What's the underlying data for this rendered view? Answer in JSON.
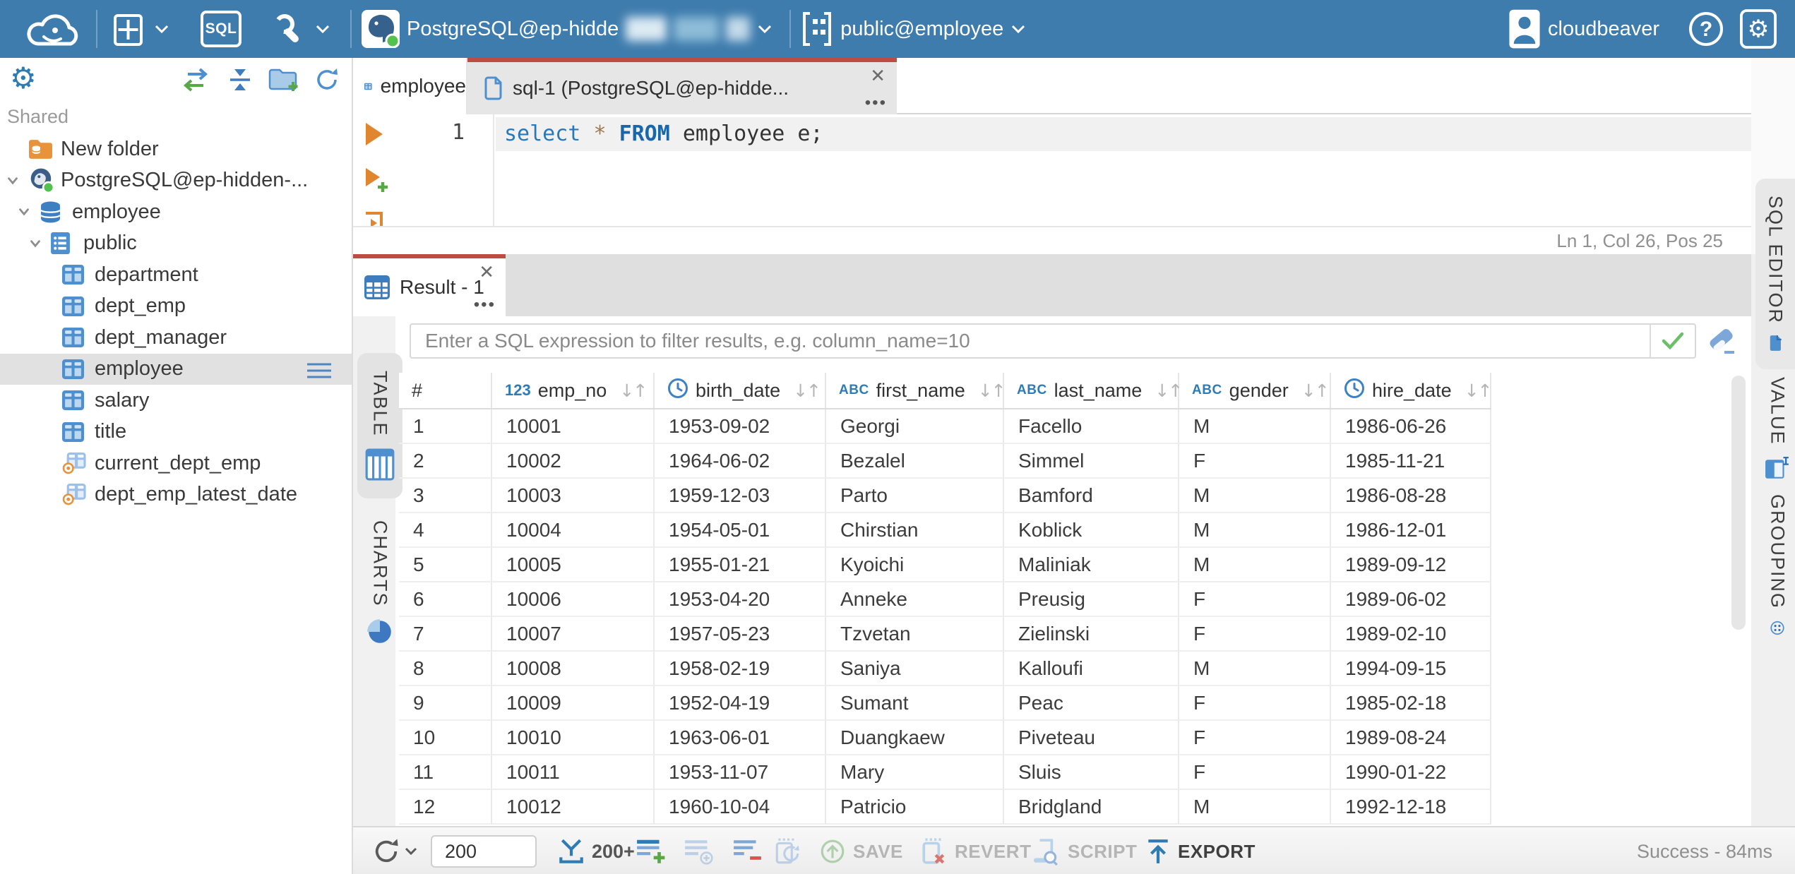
{
  "topbar": {
    "sql_badge": "SQL",
    "connection_label": "PostgreSQL@ep-hidde",
    "schema_label": "public@employee",
    "username": "cloudbeaver"
  },
  "sidebar": {
    "section_label": "Shared",
    "tree": [
      {
        "label": "New folder",
        "icon": "folder-db",
        "level": 0,
        "chevron": false,
        "selected": false
      },
      {
        "label": "PostgreSQL@ep-hidden-...",
        "icon": "postgres",
        "level": 0,
        "chevron": true,
        "selected": false
      },
      {
        "label": "employee",
        "icon": "database",
        "level": 1,
        "chevron": true,
        "selected": false
      },
      {
        "label": "public",
        "icon": "schema",
        "level": 2,
        "chevron": true,
        "selected": false
      },
      {
        "label": "department",
        "icon": "table",
        "level": 3,
        "chevron": false,
        "selected": false
      },
      {
        "label": "dept_emp",
        "icon": "table",
        "level": 3,
        "chevron": false,
        "selected": false
      },
      {
        "label": "dept_manager",
        "icon": "table",
        "level": 3,
        "chevron": false,
        "selected": false
      },
      {
        "label": "employee",
        "icon": "table",
        "level": 3,
        "chevron": false,
        "selected": true
      },
      {
        "label": "salary",
        "icon": "table",
        "level": 3,
        "chevron": false,
        "selected": false
      },
      {
        "label": "title",
        "icon": "table",
        "level": 3,
        "chevron": false,
        "selected": false
      },
      {
        "label": "current_dept_emp",
        "icon": "view",
        "level": 3,
        "chevron": false,
        "selected": false
      },
      {
        "label": "dept_emp_latest_date",
        "icon": "view",
        "level": 3,
        "chevron": false,
        "selected": false
      }
    ]
  },
  "editor": {
    "tabs": [
      {
        "label": "employee"
      },
      {
        "label": "sql-1 (PostgreSQL@ep-hidde..."
      }
    ],
    "line_number": "1",
    "sql_tokens": [
      {
        "text": "select",
        "cls": "kw"
      },
      {
        "text": " ",
        "cls": "txt"
      },
      {
        "text": "*",
        "cls": "star"
      },
      {
        "text": " ",
        "cls": "txt"
      },
      {
        "text": "FROM",
        "cls": "kwb"
      },
      {
        "text": " employee e;",
        "cls": "txt"
      }
    ],
    "status_line": "Ln 1, Col 26, Pos 25",
    "side_tab_label": "SQL EDITOR"
  },
  "result": {
    "tab_label": "Result - 1",
    "filter_placeholder": "Enter a SQL expression to filter results, e.g. column_name=10",
    "left_tabs": [
      {
        "label": "TABLE"
      },
      {
        "label": "CHARTS"
      }
    ],
    "right_tabs": [
      {
        "label": "VALUE"
      },
      {
        "label": "GROUPING"
      }
    ],
    "grid": {
      "row_header": "#",
      "columns": [
        {
          "label": "emp_no",
          "type": "123"
        },
        {
          "label": "birth_date",
          "type": "clock"
        },
        {
          "label": "first_name",
          "type": "abc"
        },
        {
          "label": "last_name",
          "type": "abc"
        },
        {
          "label": "gender",
          "type": "abc"
        },
        {
          "label": "hire_date",
          "type": "clock"
        }
      ],
      "rows": [
        [
          "1",
          "10001",
          "1953-09-02",
          "Georgi",
          "Facello",
          "M",
          "1986-06-26"
        ],
        [
          "2",
          "10002",
          "1964-06-02",
          "Bezalel",
          "Simmel",
          "F",
          "1985-11-21"
        ],
        [
          "3",
          "10003",
          "1959-12-03",
          "Parto",
          "Bamford",
          "M",
          "1986-08-28"
        ],
        [
          "4",
          "10004",
          "1954-05-01",
          "Chirstian",
          "Koblick",
          "M",
          "1986-12-01"
        ],
        [
          "5",
          "10005",
          "1955-01-21",
          "Kyoichi",
          "Maliniak",
          "M",
          "1989-09-12"
        ],
        [
          "6",
          "10006",
          "1953-04-20",
          "Anneke",
          "Preusig",
          "F",
          "1989-06-02"
        ],
        [
          "7",
          "10007",
          "1957-05-23",
          "Tzvetan",
          "Zielinski",
          "F",
          "1989-02-10"
        ],
        [
          "8",
          "10008",
          "1958-02-19",
          "Saniya",
          "Kalloufi",
          "M",
          "1994-09-15"
        ],
        [
          "9",
          "10009",
          "1952-04-19",
          "Sumant",
          "Peac",
          "F",
          "1985-02-18"
        ],
        [
          "10",
          "10010",
          "1963-06-01",
          "Duangkaew",
          "Piveteau",
          "F",
          "1989-08-24"
        ],
        [
          "11",
          "10011",
          "1953-11-07",
          "Mary",
          "Sluis",
          "F",
          "1990-01-22"
        ],
        [
          "12",
          "10012",
          "1960-10-04",
          "Patricio",
          "Bridgland",
          "M",
          "1992-12-18"
        ]
      ]
    },
    "toolbar": {
      "row_limit": "200",
      "fetch_label": "200+",
      "save_label": "SAVE",
      "revert_label": "REVERT",
      "script_label": "SCRIPT",
      "export_label": "EXPORT",
      "status": "Success - 84ms"
    }
  }
}
